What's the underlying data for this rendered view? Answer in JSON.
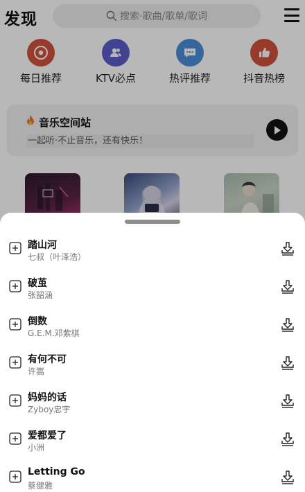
{
  "header": {
    "title": "发现",
    "search_placeholder": "搜索·歌曲/歌单/歌词"
  },
  "shortcuts": [
    {
      "label": "每日推荐",
      "icon": "vinyl-icon",
      "color": "#d3523e"
    },
    {
      "label": "KTV必点",
      "icon": "user-group-icon",
      "color": "#5a5ecb"
    },
    {
      "label": "热评推荐",
      "icon": "comment-icon",
      "color": "#4b8fd8"
    },
    {
      "label": "抖音热榜",
      "icon": "thumb-up-icon",
      "color": "#d0533d"
    }
  ],
  "station": {
    "title": "音乐空间站",
    "subtitle": "一起听·不止音乐，还有快乐！"
  },
  "songs": [
    {
      "title": "踏山河",
      "artist": "七叔（叶泽浩）"
    },
    {
      "title": "破茧",
      "artist": "张韶涵"
    },
    {
      "title": "倒数",
      "artist": "G.E.M.邓紫棋"
    },
    {
      "title": "有何不可",
      "artist": "许嵩"
    },
    {
      "title": "妈妈的话",
      "artist": "Zyboy忠宇"
    },
    {
      "title": "爱都爱了",
      "artist": "小洲"
    },
    {
      "title": "Letting Go",
      "artist": "蔡健雅"
    }
  ]
}
